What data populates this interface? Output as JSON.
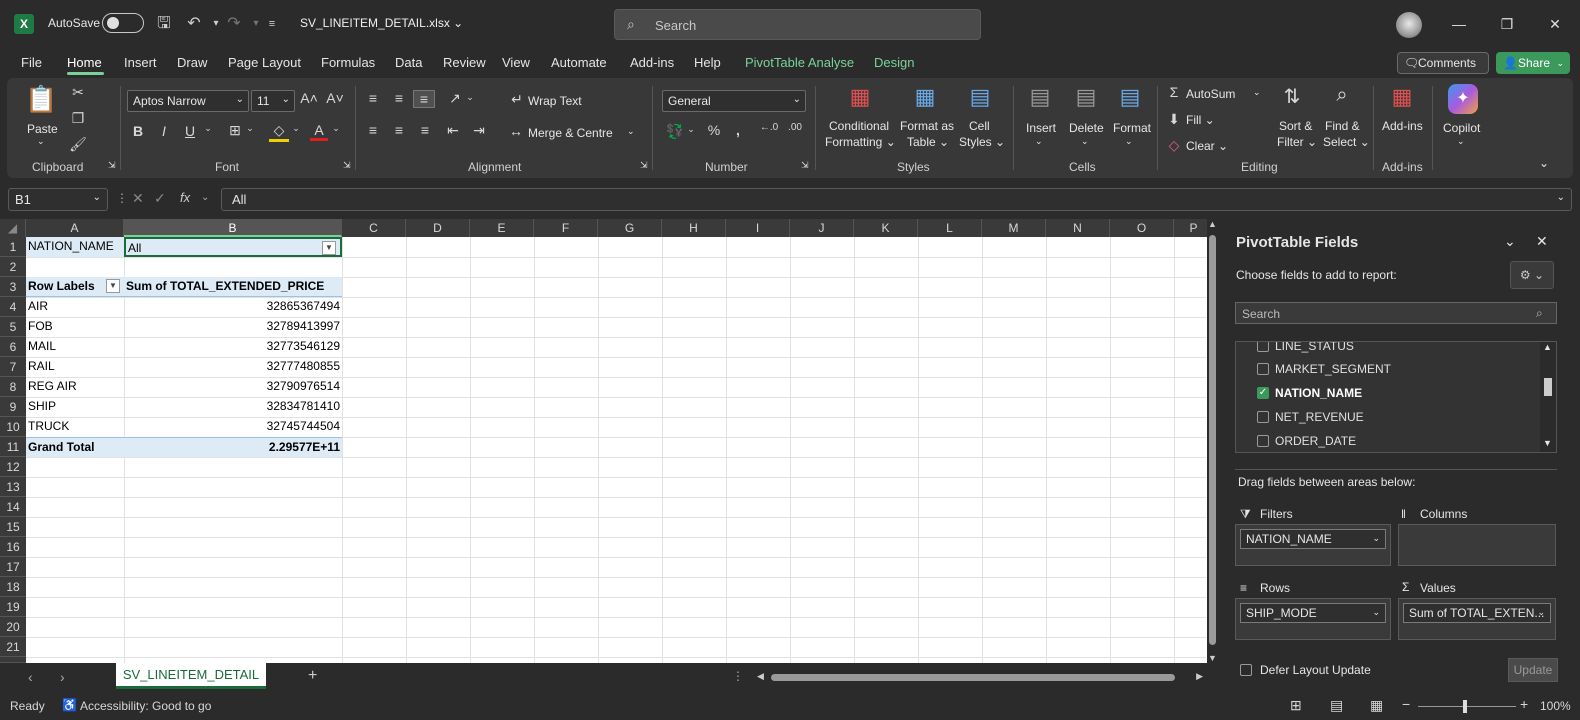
{
  "window": {
    "autosave_label": "AutoSave",
    "filename": "SV_LINEITEM_DETAIL.xlsx",
    "search_placeholder": "Search"
  },
  "menu": {
    "items": [
      "File",
      "Home",
      "Insert",
      "Draw",
      "Page Layout",
      "Formulas",
      "Data",
      "Review",
      "View",
      "Automate",
      "Add-ins",
      "Help",
      "PivotTable Analyse",
      "Design"
    ],
    "comments": "Comments",
    "share": "Share"
  },
  "ribbon": {
    "clipboard": {
      "paste": "Paste",
      "label": "Clipboard"
    },
    "font": {
      "name": "Aptos Narrow",
      "size": "11",
      "label": "Font"
    },
    "alignment": {
      "wrap": "Wrap Text",
      "merge": "Merge & Centre",
      "label": "Alignment"
    },
    "number": {
      "format": "General",
      "label": "Number"
    },
    "styles": {
      "cond1": "Conditional",
      "cond2": "Formatting",
      "fmt1": "Format as",
      "fmt2": "Table",
      "cell1": "Cell",
      "cell2": "Styles",
      "label": "Styles"
    },
    "cells": {
      "insert": "Insert",
      "delete": "Delete",
      "format": "Format",
      "label": "Cells"
    },
    "editing": {
      "autosum": "AutoSum",
      "fill": "Fill",
      "clear": "Clear",
      "sort1": "Sort &",
      "sort2": "Filter",
      "find1": "Find &",
      "find2": "Select",
      "label": "Editing"
    },
    "addins": {
      "addins": "Add-ins",
      "label": "Add-ins"
    },
    "copilot": {
      "label": "Copilot"
    }
  },
  "formula_bar": {
    "namebox": "B1",
    "fx": "fx",
    "content": "All"
  },
  "grid": {
    "columns": [
      "A",
      "B",
      "C",
      "D",
      "E",
      "F",
      "G",
      "H",
      "I",
      "J",
      "K",
      "L",
      "M",
      "N",
      "O",
      "P"
    ],
    "rows": [
      "1",
      "2",
      "3",
      "4",
      "5",
      "6",
      "7",
      "8",
      "9",
      "10",
      "11",
      "12",
      "13",
      "14",
      "15",
      "16",
      "17",
      "18",
      "19",
      "20",
      "21"
    ],
    "filter_label": "NATION_NAME",
    "filter_value": "All",
    "header_rows": "Row Labels",
    "header_values": "Sum of TOTAL_EXTENDED_PRICE",
    "data": [
      {
        "label": "AIR",
        "value": "32865367494"
      },
      {
        "label": "FOB",
        "value": "32789413997"
      },
      {
        "label": "MAIL",
        "value": "32773546129"
      },
      {
        "label": "RAIL",
        "value": "32777480855"
      },
      {
        "label": "REG AIR",
        "value": "32790976514"
      },
      {
        "label": "SHIP",
        "value": "32834781410"
      },
      {
        "label": "TRUCK",
        "value": "32745744504"
      }
    ],
    "grand_total_label": "Grand Total",
    "grand_total_value": "2.29577E+11"
  },
  "sheets": {
    "active": "SV_LINEITEM_DETAIL"
  },
  "status": {
    "ready": "Ready",
    "accessibility": "Accessibility: Good to go",
    "zoom": "100%"
  },
  "pivot": {
    "title": "PivotTable Fields",
    "subtitle": "Choose fields to add to report:",
    "search_placeholder": "Search",
    "fields": [
      {
        "name": "LINE_STATUS",
        "checked": false
      },
      {
        "name": "MARKET_SEGMENT",
        "checked": false
      },
      {
        "name": "NATION_NAME",
        "checked": true
      },
      {
        "name": "NET_REVENUE",
        "checked": false
      },
      {
        "name": "ORDER_DATE",
        "checked": false
      }
    ],
    "drag_hint": "Drag fields between areas below:",
    "filters_label": "Filters",
    "columns_label": "Columns",
    "rows_label": "Rows",
    "values_label": "Values",
    "filters_item": "NATION_NAME",
    "rows_item": "SHIP_MODE",
    "values_item": "Sum of TOTAL_EXTEN...",
    "defer": "Defer Layout Update",
    "update": "Update"
  }
}
